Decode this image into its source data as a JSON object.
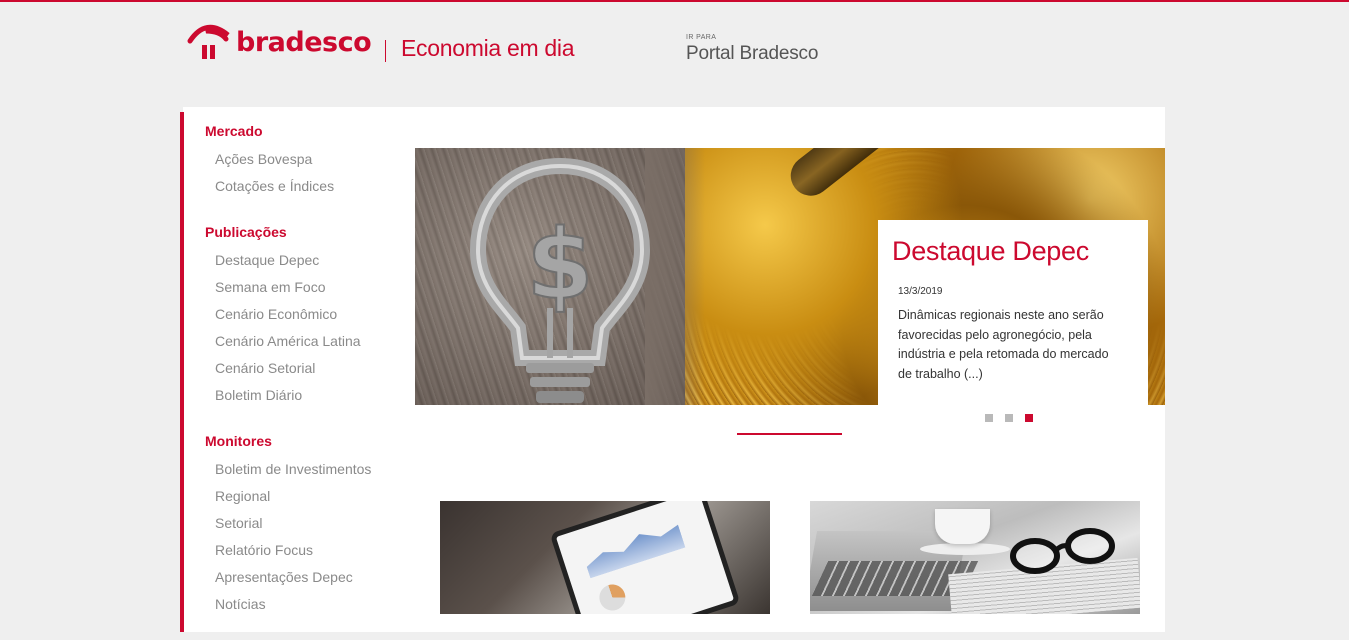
{
  "header": {
    "brand": "bradesco",
    "site_title": "Economia em dia",
    "portal_small": "IR PARA",
    "portal_link": "Portal Bradesco"
  },
  "sidebar": {
    "sections": [
      {
        "title": "Mercado",
        "items": [
          "Ações Bovespa",
          "Cotações e Índices"
        ]
      },
      {
        "title": "Publicações",
        "items": [
          "Destaque Depec",
          "Semana em Foco",
          "Cenário Econômico",
          "Cenário América Latina",
          "Cenário Setorial",
          "Boletim Diário"
        ]
      },
      {
        "title": "Monitores",
        "items": [
          "Boletim de Investimentos",
          "Regional",
          "Setorial",
          "Relatório Focus",
          "Apresentações Depec",
          "Notícias"
        ]
      }
    ]
  },
  "hero": {
    "title": "Destaque Depec",
    "date": "13/3/2019",
    "text": "Dinâmicas regionais neste ano serão favorecidas pelo agronegócio, pela indústria e pela retomada do mercado de trabalho (...)",
    "slides_total": 3,
    "active_slide": 3
  },
  "colors": {
    "brand_red": "#cc092f",
    "menu_gray": "#8a8a8a",
    "background": "#efefef"
  },
  "icons": [
    "bradesco-logo-icon",
    "lightbulb-dollar-icon"
  ]
}
